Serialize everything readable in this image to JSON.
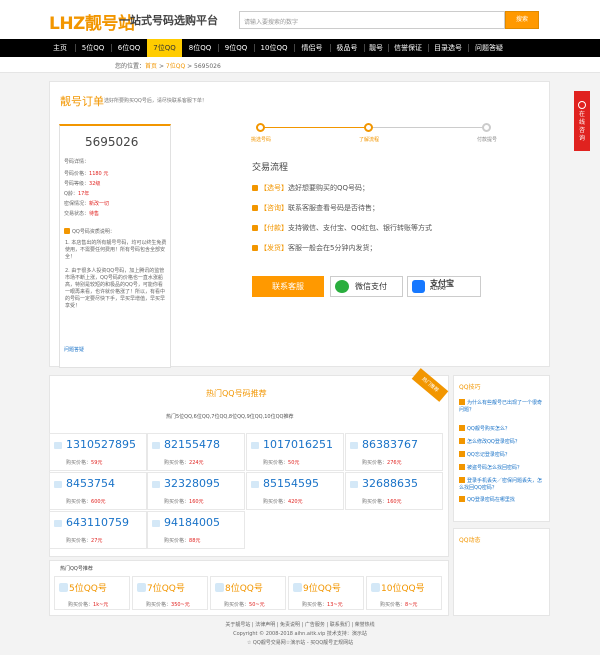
{
  "header": {
    "logo_text": "LHZ靓号站",
    "slogan": "一站式号码选购平台",
    "search_placeholder": "请输入要搜索的数字",
    "search_button": "搜索"
  },
  "nav": {
    "items": [
      "主页",
      "5位QQ",
      "6位QQ",
      "7位QQ",
      "8位QQ",
      "9位QQ",
      "10位QQ",
      "情侣号",
      "极品号",
      "靓号",
      "信誉保证",
      "目录选号",
      "问题答疑"
    ],
    "active_index": 3
  },
  "breadcrumb": {
    "prefix": "您的位置：",
    "home": "首页",
    "category": "7位QQ",
    "current": "5695026",
    "sep": ">"
  },
  "order": {
    "title": "靓号订单",
    "subtitle": "选好所要购买QQ号后，请尽快联系客服下单！",
    "number": "5695026",
    "details": [
      {
        "label": "号码详情：",
        "value": ""
      },
      {
        "label": "号码价格：",
        "value": "1180 元"
      },
      {
        "label": "号码等级：",
        "value": "32级"
      },
      {
        "label": "Q龄：",
        "value": "17年"
      },
      {
        "label": "密保情况：",
        "value": "新改一切"
      },
      {
        "label": "交易状态：",
        "value": "待售"
      }
    ],
    "notice_title": "QQ号码资质说明：",
    "notice_1": "1. 本店售出的所有靓号号码，均可以终生免费使用，不需要任何费用！所有号码包含全部安全！",
    "notice_2": "2. 由于很多人投资QQ号码，加上腾讯的监管市场不断上涨，QQ号码的价格也一直水涨船高，特别是较短的和极品的QQ号，可能你看一眼再来看，也许就价格涨了！所以，有看中的号码一定要尽快下手，早买早增值，早买早享受！",
    "faq_link": "问题答疑"
  },
  "steps": {
    "items": [
      "挑选号码",
      "了解流程",
      "付款提号"
    ]
  },
  "flow": {
    "title": "交易流程",
    "items": [
      {
        "key": "【选号】",
        "text": "选好想要购买的QQ号码；"
      },
      {
        "key": "【咨询】",
        "text": "联系客服查看号码是否待售；"
      },
      {
        "key": "【付款】",
        "text": "支持微信、支付宝、QQ红包、银行转账等方式"
      },
      {
        "key": "【发货】",
        "text": "客服一般会在5分钟内发货；"
      }
    ],
    "contact_button": "联系客服",
    "wechat_label": "微信支付",
    "alipay_label": "支付宝",
    "alipay_sub": "ALIPAY"
  },
  "hot": {
    "title": "热门QQ号码推荐",
    "ribbon": "热门推荐",
    "subtitle": "热门5位QQ,6位QQ,7位QQ,8位QQ,9位QQ,10位QQ推荐",
    "price_prefix": "购买价格：",
    "numbers": [
      {
        "num": "1310527895",
        "price": "59元"
      },
      {
        "num": "82155478",
        "price": "224元"
      },
      {
        "num": "1017016251",
        "price": "50元"
      },
      {
        "num": "86383767",
        "price": "276元"
      },
      {
        "num": "8453754",
        "price": "600元"
      },
      {
        "num": "32328095",
        "price": "160元"
      },
      {
        "num": "85154595",
        "price": "420元"
      },
      {
        "num": "32688635",
        "price": "160元"
      },
      {
        "num": "643110759",
        "price": "27元"
      },
      {
        "num": "94184005",
        "price": "88元"
      }
    ]
  },
  "categories": {
    "title": "热门QQ号推荐",
    "price_prefix": "购买价格：",
    "items": [
      {
        "name": "5位QQ号",
        "price": "1k~元"
      },
      {
        "name": "7位QQ号",
        "price": "350~元"
      },
      {
        "name": "8位QQ号",
        "price": "50~元"
      },
      {
        "name": "9位QQ号",
        "price": "13~元"
      },
      {
        "name": "10位QQ号",
        "price": "8~元"
      }
    ]
  },
  "sidebar": {
    "tips_title": "QQ技巧",
    "tips": [
      "为什么有些靓号已出现了一个很奇问题？",
      "QQ靓号购买怎么？",
      "怎么修改QQ登录密码？",
      "QQ忘记登录密码？",
      "被盗号码怎么找回密码？",
      "登录手机丢失／密保问题丢失，怎么找回QQ密码？",
      "QQ登录密码在哪里找"
    ],
    "dynamic_title": "QQ动态"
  },
  "footer": {
    "links": "关于靓号站 | 法律声明 | 免责说明 | 广告服务 | 联系我们 | 荣誉热线",
    "copyright": "Copyright © 2008-2018 aihn.aitk.vip 技术支持：演示站",
    "line3": "☆ QQ靓号交易网☆演示站 - 买QQ靓号正规网站"
  },
  "float": {
    "label": "在线咨询"
  },
  "colors": {
    "accent": "#f29600",
    "price_red": "#e0221f",
    "link_blue": "#1a73c8",
    "nav_bg": "#000000",
    "nav_active": "#ffcc00"
  }
}
